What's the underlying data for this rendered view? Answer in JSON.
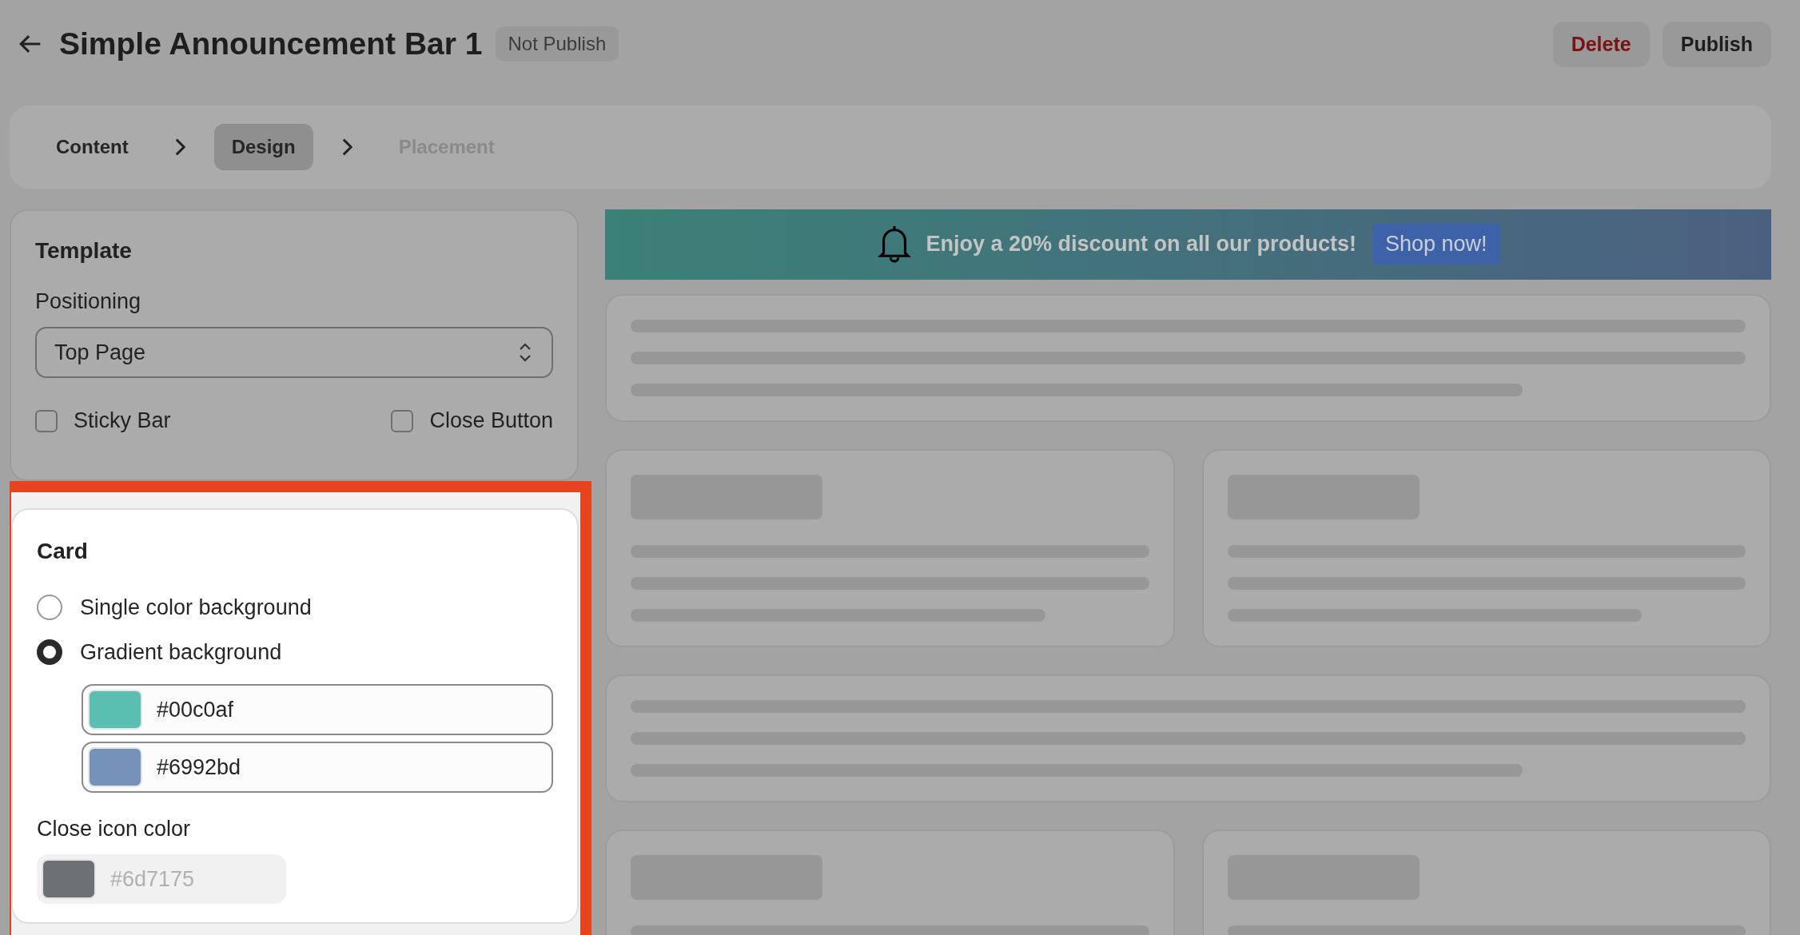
{
  "header": {
    "title": "Simple Announcement Bar 1",
    "status": "Not Publish",
    "actions": [
      {
        "label": "Delete",
        "kind": "danger"
      },
      {
        "label": "Publish",
        "kind": "default"
      }
    ]
  },
  "steps": [
    {
      "label": "Content",
      "selected": false,
      "disabled": false
    },
    {
      "label": "Design",
      "selected": true,
      "disabled": false
    },
    {
      "label": "Placement",
      "selected": false,
      "disabled": true
    }
  ],
  "template": {
    "title": "Template",
    "positioning_label": "Positioning",
    "positioning_value": "Top Page",
    "checkboxes": [
      {
        "label": "Sticky Bar",
        "checked": false
      },
      {
        "label": "Close Button",
        "checked": false
      }
    ]
  },
  "card": {
    "title": "Card",
    "highlighted": true,
    "background_options": [
      {
        "label": "Single color background",
        "selected": false
      },
      {
        "label": "Gradient background",
        "selected": true
      }
    ],
    "gradient_colors": [
      {
        "value": "#00c0af",
        "color": "#5abfb0"
      },
      {
        "value": "#6992bd",
        "color": "#7592bb"
      }
    ],
    "close_icon": {
      "label": "Close icon color",
      "value": "#6d7175",
      "color": "#6d7175",
      "disabled": true
    }
  },
  "preview": {
    "banner": {
      "text": "Enjoy a 20% discount on all our products!",
      "button": "Shop now!"
    }
  }
}
